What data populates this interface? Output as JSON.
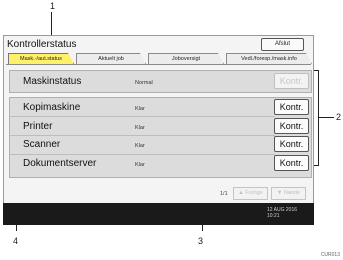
{
  "callouts": [
    "1",
    "2",
    "3",
    "4"
  ],
  "window": {
    "title": "Kontrollerstatus",
    "exit_label": "Afslut"
  },
  "tabs": [
    {
      "label": "Mask.-/aut.status",
      "active": true
    },
    {
      "label": "Aktuelt job",
      "active": false
    },
    {
      "label": "Joboversigt",
      "active": false
    },
    {
      "label": "Vedl./foresp./mask.info",
      "active": false
    }
  ],
  "machine_status": {
    "label": "Maskinstatus",
    "status": "Normal",
    "button": "Kontr."
  },
  "functions": [
    {
      "label": "Kopimaskine",
      "status": "Klar",
      "button": "Kontr."
    },
    {
      "label": "Printer",
      "status": "Klar",
      "button": "Kontr."
    },
    {
      "label": "Scanner",
      "status": "Klar",
      "button": "Kontr."
    },
    {
      "label": "Dokumentserver",
      "status": "Klar",
      "button": "Kontr."
    }
  ],
  "pager": {
    "indicator": "1/1",
    "prev_label": "▲ Forrige",
    "next_label": "▼ Næste"
  },
  "footer": {
    "date": "12 AUG 2016",
    "time": "10:21"
  },
  "figure_id": "CUR013",
  "colors": {
    "active_tab": "#fff06a",
    "panel": "#dcdcdc",
    "footer": "#1a1a1a"
  }
}
